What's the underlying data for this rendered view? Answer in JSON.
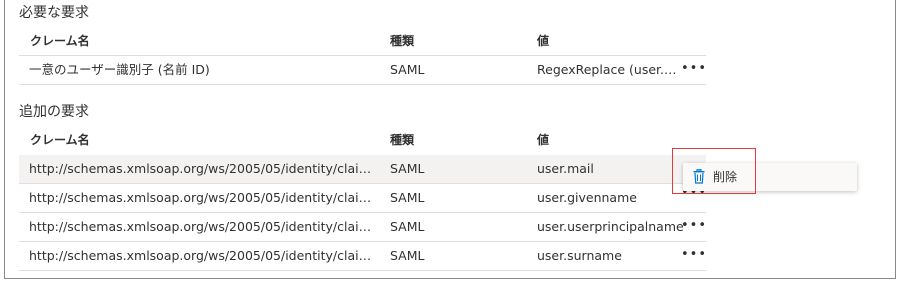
{
  "required": {
    "title": "必要な要求",
    "headers": {
      "name": "クレーム名",
      "type": "種類",
      "value": "値"
    },
    "rows": [
      {
        "name": "一意のユーザー識別子 (名前 ID)",
        "type": "SAML",
        "value": "RegexReplace (user.u…",
        "more": "•••"
      }
    ]
  },
  "additional": {
    "title": "追加の要求",
    "headers": {
      "name": "クレーム名",
      "type": "種類",
      "value": "値"
    },
    "rows": [
      {
        "name": "http://schemas.xmlsoap.org/ws/2005/05/identity/claims/…",
        "type": "SAML",
        "value": "user.mail",
        "more": ""
      },
      {
        "name": "http://schemas.xmlsoap.org/ws/2005/05/identity/claims/…",
        "type": "SAML",
        "value": "user.givenname",
        "more": "•••"
      },
      {
        "name": "http://schemas.xmlsoap.org/ws/2005/05/identity/claims/…",
        "type": "SAML",
        "value": "user.userprincipalname",
        "more": "•••"
      },
      {
        "name": "http://schemas.xmlsoap.org/ws/2005/05/identity/claims/…",
        "type": "SAML",
        "value": "user.surname",
        "more": "•••"
      }
    ]
  },
  "context_menu": {
    "items": [
      {
        "icon": "trash-icon",
        "label": "削除"
      }
    ]
  },
  "colors": {
    "highlight": "#e03c3c",
    "accent": "#0078d4",
    "selected_row": "#f3f2f1"
  }
}
